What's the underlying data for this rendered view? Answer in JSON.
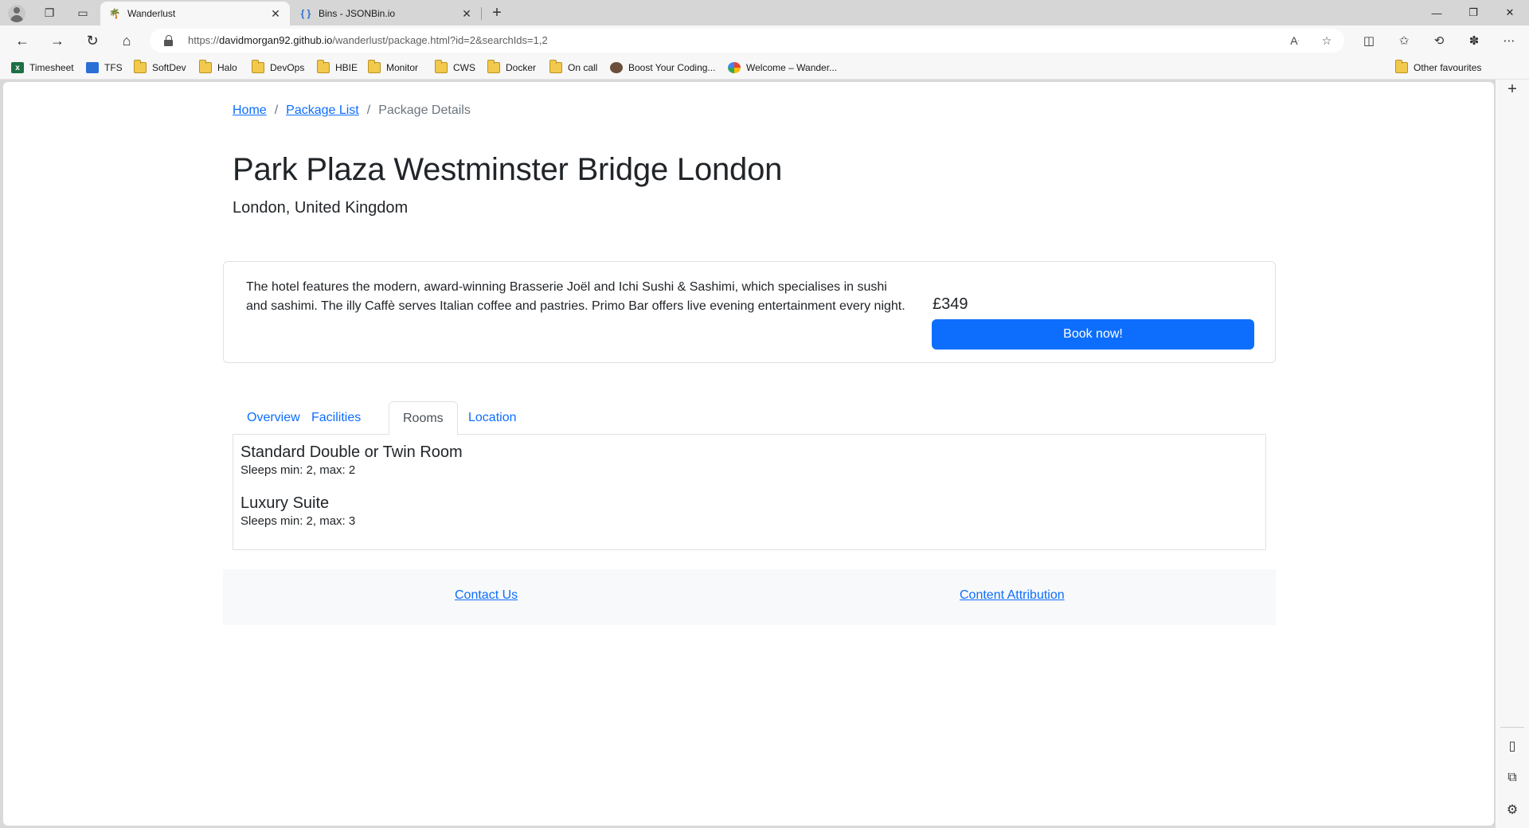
{
  "browser": {
    "tabs": [
      {
        "title": "Wanderlust",
        "active": true
      },
      {
        "title": "Bins - JSONBin.io",
        "active": false
      }
    ],
    "address": {
      "scheme": "https://",
      "host": "davidmorgan92.github.io",
      "path": "/wanderlust/package.html?id=2&searchIds=1,2"
    },
    "favourites": [
      {
        "label": "Timesheet",
        "icon": "excel-icon"
      },
      {
        "label": "TFS",
        "icon": "tfs-icon"
      },
      {
        "label": "SoftDev",
        "icon": "folder-icon"
      },
      {
        "label": "Halo",
        "icon": "folder-icon"
      },
      {
        "label": "DevOps",
        "icon": "folder-icon"
      },
      {
        "label": "HBIE",
        "icon": "folder-icon"
      },
      {
        "label": "Monitor",
        "icon": "folder-icon"
      },
      {
        "label": "CWS",
        "icon": "folder-icon"
      },
      {
        "label": "Docker",
        "icon": "folder-icon"
      },
      {
        "label": "On call",
        "icon": "folder-icon"
      },
      {
        "label": "Boost Your Coding...",
        "icon": "boost-icon"
      },
      {
        "label": "Welcome – Wander...",
        "icon": "google-cloud-icon"
      }
    ],
    "other_favourites": "Other favourites"
  },
  "page": {
    "breadcrumb": {
      "home": "Home",
      "package_list": "Package List",
      "current": "Package Details",
      "separator": "/"
    },
    "hotel_name": "Park Plaza Westminster Bridge London",
    "location": "London, United Kingdom",
    "description": "The hotel features the modern, award-winning Brasserie Joël and Ichi Sushi & Sashimi, which specialises in sushi and sashimi. The illy Caffè serves Italian coffee and pastries. Primo Bar offers live evening entertainment every night.",
    "price": "£349",
    "book_label": "Book now!",
    "tabs": [
      "Overview",
      "Facilities",
      "Rooms",
      "Location"
    ],
    "active_tab": "Rooms",
    "rooms": [
      {
        "name": "Standard Double or Twin Room",
        "sleeps": "Sleeps min: 2, max: 2"
      },
      {
        "name": "Luxury Suite",
        "sleeps": "Sleeps min: 2, max: 3"
      }
    ],
    "footer": {
      "contact": "Contact Us",
      "attribution": "Content Attribution"
    }
  },
  "colors": {
    "primary": "#0d6efd",
    "text": "#212529",
    "muted": "#6c757d",
    "border": "#dee2e6",
    "footer_bg": "#f8f9fa"
  }
}
